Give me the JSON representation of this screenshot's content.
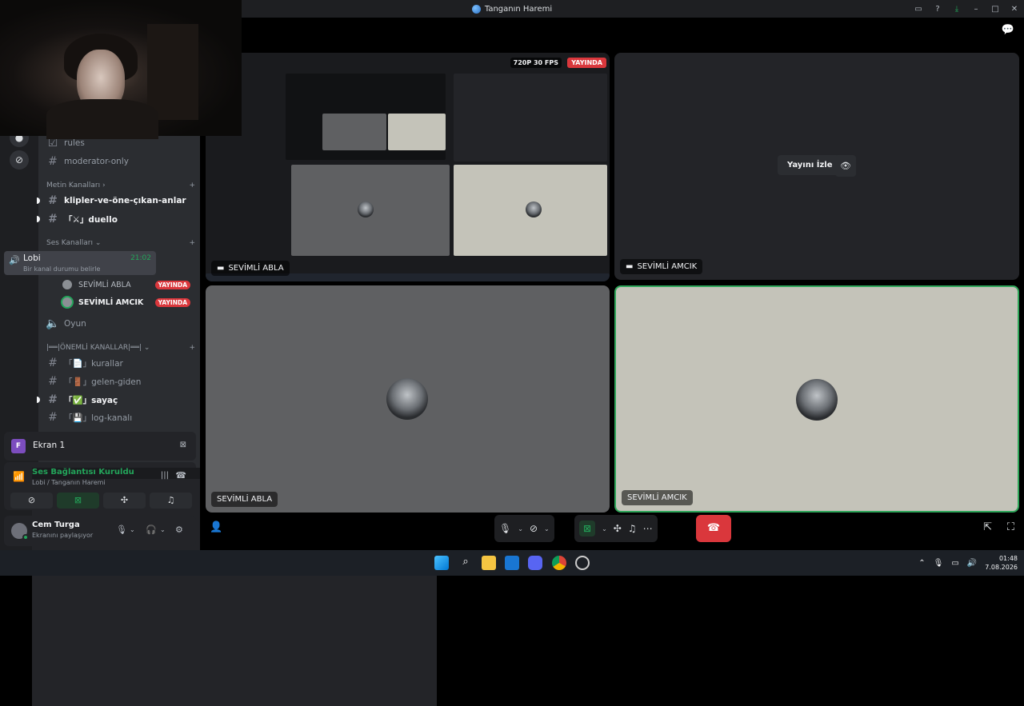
{
  "window": {
    "title": "Tanganın Haremi"
  },
  "channels": {
    "rules": "rules",
    "moderator_only": "moderator-only",
    "cat_text": "Metin Kanalları",
    "text": [
      {
        "label": "klipler-ve-öne-çıkan-anlar"
      },
      {
        "label": "「⚔」duello"
      }
    ],
    "cat_voice": "Ses Kanalları",
    "voice_lobi": {
      "name": "Lobi",
      "time": "21:02",
      "status": "Bir kanal durumu belirle"
    },
    "voice_users": [
      {
        "name": "SEVİMLİ ABLA",
        "badge": "YAYINDA"
      },
      {
        "name": "SEVİMLİ AMCIK",
        "badge": "YAYINDA"
      }
    ],
    "oyun": "Oyun",
    "cat_important": "|══|ÖNEMLİ KANALLAR|══|",
    "important": [
      {
        "label": "「📄」kurallar"
      },
      {
        "label": "「🚪」gelen-giden"
      },
      {
        "label": "「✅」sayaç"
      },
      {
        "label": "「💾」log-kanalı"
      }
    ]
  },
  "screen_panel": {
    "initial": "F",
    "label": "Ekran 1"
  },
  "connection": {
    "status": "Ses Bağlantısı Kuruldu",
    "location": "Lobi / Tanganın Haremi"
  },
  "user": {
    "name": "Cem Turga",
    "status": "Ekranını paylaşıyor"
  },
  "tiles": [
    {
      "name": "SEVİMLİ ABLA",
      "fps": "720P 30 FPS",
      "live": "YAYINDA"
    },
    {
      "name": "SEVİMLİ AMCIK",
      "watch": "Yayını İzle"
    },
    {
      "name": "SEVİMLİ ABLA"
    },
    {
      "name": "SEVİMLİ AMCIK"
    }
  ],
  "taskbar": {
    "time": "01:48",
    "date": "7.08.2026"
  }
}
